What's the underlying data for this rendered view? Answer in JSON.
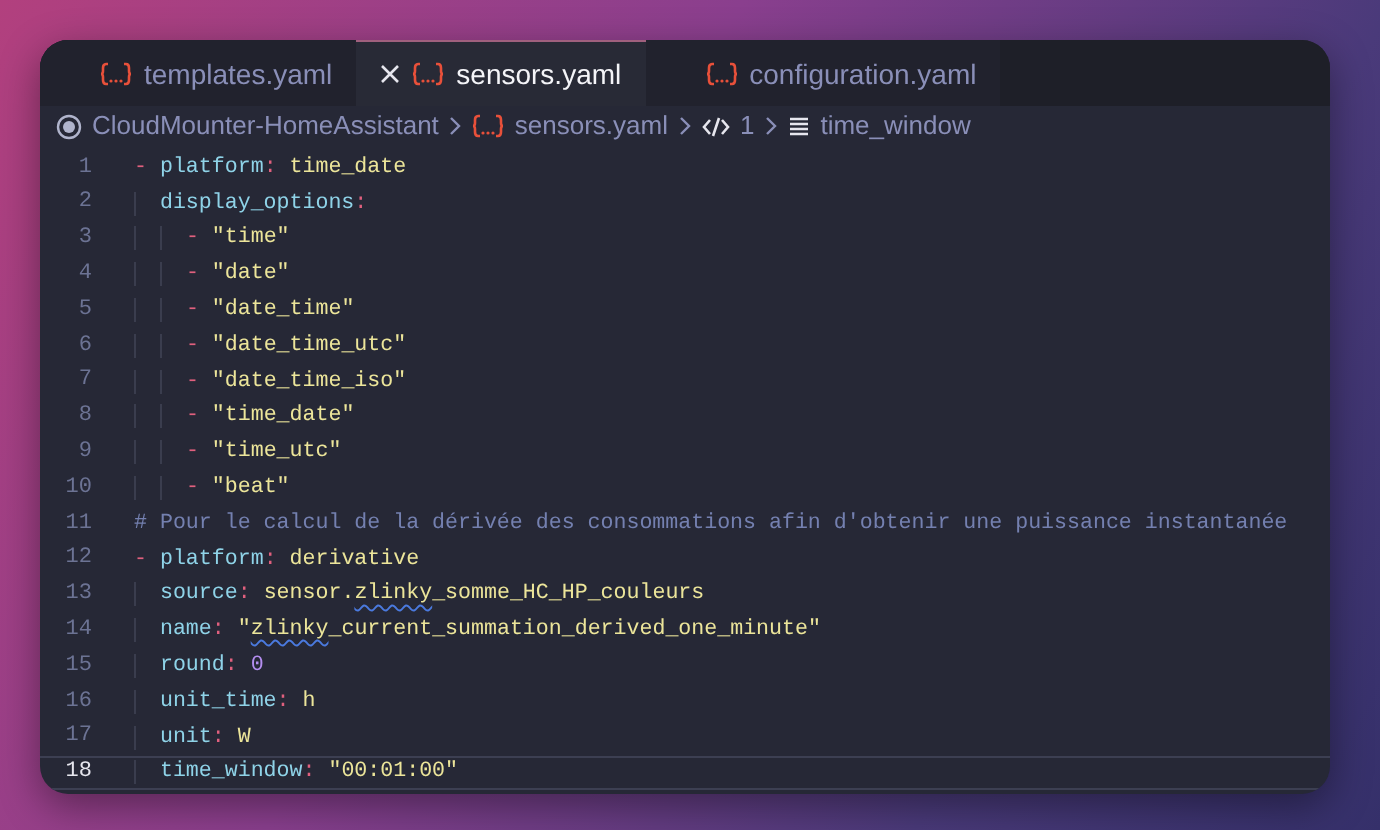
{
  "tabs": [
    {
      "label": "templates.yaml",
      "selected": false,
      "closable": false
    },
    {
      "label": "sensors.yaml",
      "selected": true,
      "closable": true
    },
    {
      "label": "configuration.yaml",
      "selected": false,
      "closable": false
    }
  ],
  "breadcrumb": [
    {
      "kind": "folder",
      "text": "CloudMounter-HomeAssistant"
    },
    {
      "kind": "file",
      "text": "sensors.yaml"
    },
    {
      "kind": "node",
      "text": "1"
    },
    {
      "kind": "field",
      "text": "time_window"
    }
  ],
  "lines": [
    {
      "number": "1",
      "current": false,
      "tokens": [
        {
          "kind": "dash",
          "text": "- "
        },
        {
          "kind": "key",
          "text": "platform"
        },
        {
          "kind": "punct",
          "text": ": "
        },
        {
          "kind": "value",
          "text": "time_date"
        }
      ]
    },
    {
      "number": "2",
      "current": false,
      "tokens": [
        {
          "kind": "key",
          "text": "  display_options"
        },
        {
          "kind": "punct",
          "text": ":"
        }
      ]
    },
    {
      "number": "3",
      "current": false,
      "tokens": [
        {
          "kind": "dash",
          "text": "    - "
        },
        {
          "kind": "value",
          "text": "\"time\""
        }
      ]
    },
    {
      "number": "4",
      "current": false,
      "tokens": [
        {
          "kind": "dash",
          "text": "    - "
        },
        {
          "kind": "value",
          "text": "\"date\""
        }
      ]
    },
    {
      "number": "5",
      "current": false,
      "tokens": [
        {
          "kind": "dash",
          "text": "    - "
        },
        {
          "kind": "value",
          "text": "\"date_time\""
        }
      ]
    },
    {
      "number": "6",
      "current": false,
      "tokens": [
        {
          "kind": "dash",
          "text": "    - "
        },
        {
          "kind": "value",
          "text": "\"date_time_utc\""
        }
      ]
    },
    {
      "number": "7",
      "current": false,
      "tokens": [
        {
          "kind": "dash",
          "text": "    - "
        },
        {
          "kind": "value",
          "text": "\"date_time_iso\""
        }
      ]
    },
    {
      "number": "8",
      "current": false,
      "tokens": [
        {
          "kind": "dash",
          "text": "    - "
        },
        {
          "kind": "value",
          "text": "\"time_date\""
        }
      ]
    },
    {
      "number": "9",
      "current": false,
      "tokens": [
        {
          "kind": "dash",
          "text": "    - "
        },
        {
          "kind": "value",
          "text": "\"time_utc\""
        }
      ]
    },
    {
      "number": "10",
      "current": false,
      "tokens": [
        {
          "kind": "dash",
          "text": "    - "
        },
        {
          "kind": "value",
          "text": "\"beat\""
        }
      ]
    },
    {
      "number": "11",
      "current": false,
      "tokens": [
        {
          "kind": "comment",
          "text": "# Pour le calcul de la dérivée des consommations afin d'obtenir une puissance instantanée"
        }
      ]
    },
    {
      "number": "12",
      "current": false,
      "tokens": [
        {
          "kind": "dash",
          "text": "- "
        },
        {
          "kind": "key",
          "text": "platform"
        },
        {
          "kind": "punct",
          "text": ": "
        },
        {
          "kind": "value",
          "text": "derivative"
        }
      ]
    },
    {
      "number": "13",
      "current": false,
      "tokens": [
        {
          "kind": "key",
          "text": "  source"
        },
        {
          "kind": "punct",
          "text": ": "
        },
        {
          "kind": "value",
          "text": "sensor."
        },
        {
          "kind": "value",
          "text": "zlinky",
          "squiggly": true
        },
        {
          "kind": "value",
          "text": "_somme_HC_HP_couleurs"
        }
      ]
    },
    {
      "number": "14",
      "current": false,
      "tokens": [
        {
          "kind": "key",
          "text": "  name"
        },
        {
          "kind": "punct",
          "text": ": "
        },
        {
          "kind": "value",
          "text": "\""
        },
        {
          "kind": "value",
          "text": "zlinky",
          "squiggly": true
        },
        {
          "kind": "value",
          "text": "_current_summation_derived_one_minute\""
        }
      ]
    },
    {
      "number": "15",
      "current": false,
      "tokens": [
        {
          "kind": "key",
          "text": "  round"
        },
        {
          "kind": "punct",
          "text": ": "
        },
        {
          "kind": "number",
          "text": "0"
        }
      ]
    },
    {
      "number": "16",
      "current": false,
      "tokens": [
        {
          "kind": "key",
          "text": "  unit_time"
        },
        {
          "kind": "punct",
          "text": ": "
        },
        {
          "kind": "value",
          "text": "h"
        }
      ]
    },
    {
      "number": "17",
      "current": false,
      "tokens": [
        {
          "kind": "key",
          "text": "  unit"
        },
        {
          "kind": "punct",
          "text": ": "
        },
        {
          "kind": "value",
          "text": "W"
        }
      ]
    },
    {
      "number": "18",
      "current": true,
      "tokens": [
        {
          "kind": "key",
          "text": "  time_window"
        },
        {
          "kind": "punct",
          "text": ": "
        },
        {
          "kind": "value",
          "text": "\"00:01:00\""
        }
      ]
    }
  ]
}
